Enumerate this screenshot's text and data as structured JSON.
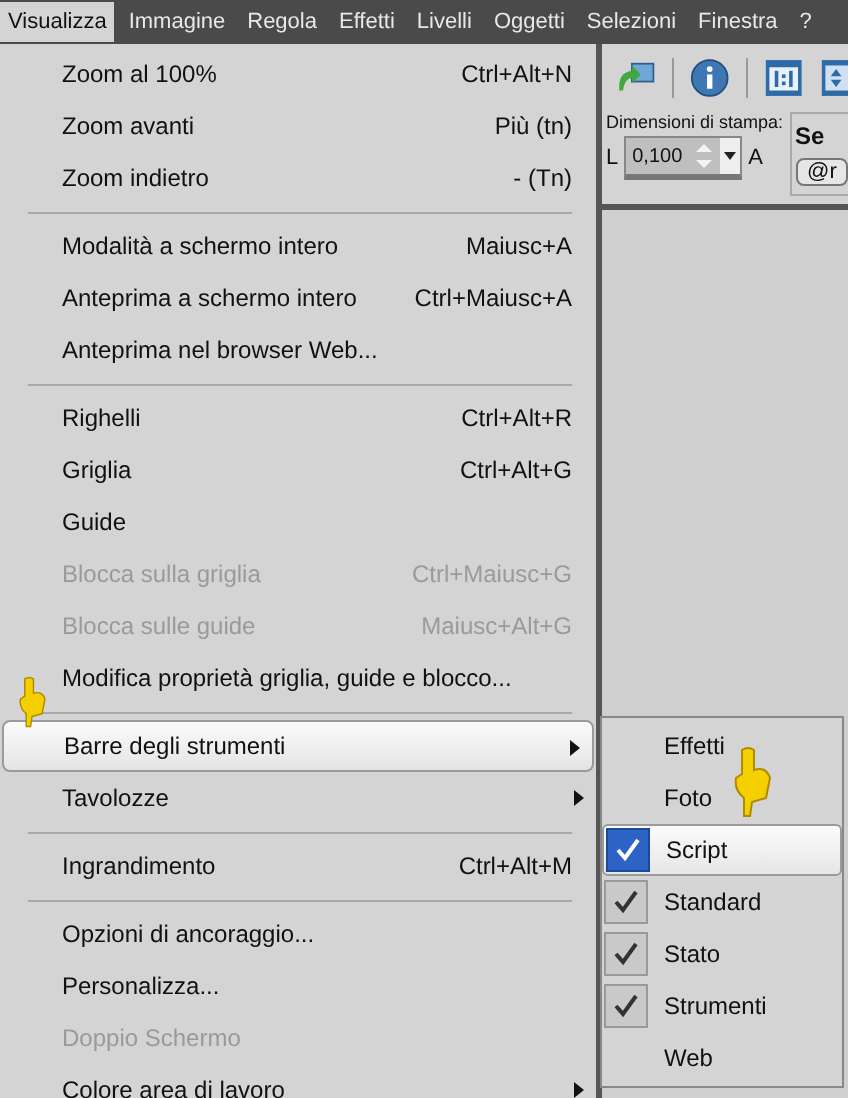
{
  "menubar": [
    {
      "label": "Visualizza",
      "selected": true
    },
    {
      "label": "Immagine",
      "selected": false
    },
    {
      "label": "Regola",
      "selected": false
    },
    {
      "label": "Effetti",
      "selected": false
    },
    {
      "label": "Livelli",
      "selected": false
    },
    {
      "label": "Oggetti",
      "selected": false
    },
    {
      "label": "Selezioni",
      "selected": false
    },
    {
      "label": "Finestra",
      "selected": false
    },
    {
      "label": "?",
      "selected": false
    }
  ],
  "menu": {
    "items": [
      {
        "kind": "item",
        "label": "Zoom al 100%",
        "shortcut": "Ctrl+Alt+N",
        "disabled": false,
        "selected": false,
        "submenu": false
      },
      {
        "kind": "item",
        "label": "Zoom avanti",
        "shortcut": "Più (tn)",
        "disabled": false,
        "selected": false,
        "submenu": false
      },
      {
        "kind": "item",
        "label": "Zoom indietro",
        "shortcut": "- (Tn)",
        "disabled": false,
        "selected": false,
        "submenu": false
      },
      {
        "kind": "separator"
      },
      {
        "kind": "item",
        "label": "Modalità a schermo intero",
        "shortcut": "Maiusc+A",
        "disabled": false,
        "selected": false,
        "submenu": false
      },
      {
        "kind": "item",
        "label": "Anteprima a schermo intero",
        "shortcut": "Ctrl+Maiusc+A",
        "disabled": false,
        "selected": false,
        "submenu": false
      },
      {
        "kind": "item",
        "label": "Anteprima nel browser Web...",
        "disabled": false,
        "selected": false,
        "submenu": false
      },
      {
        "kind": "separator"
      },
      {
        "kind": "item",
        "label": "Righelli",
        "shortcut": "Ctrl+Alt+R",
        "disabled": false,
        "selected": false,
        "submenu": false
      },
      {
        "kind": "item",
        "label": "Griglia",
        "shortcut": "Ctrl+Alt+G",
        "disabled": false,
        "selected": false,
        "submenu": false
      },
      {
        "kind": "item",
        "label": "Guide",
        "disabled": false,
        "selected": false,
        "submenu": false
      },
      {
        "kind": "item",
        "label": "Blocca sulla griglia",
        "shortcut": "Ctrl+Maiusc+G",
        "disabled": true,
        "selected": false,
        "submenu": false
      },
      {
        "kind": "item",
        "label": "Blocca sulle guide",
        "shortcut": "Maiusc+Alt+G",
        "disabled": true,
        "selected": false,
        "submenu": false
      },
      {
        "kind": "item",
        "label": "Modifica proprietà griglia, guide e blocco...",
        "disabled": false,
        "selected": false,
        "submenu": false
      },
      {
        "kind": "separator"
      },
      {
        "kind": "item",
        "label": "Barre degli strumenti",
        "disabled": false,
        "selected": true,
        "submenu": true
      },
      {
        "kind": "item",
        "label": "Tavolozze",
        "disabled": false,
        "selected": false,
        "submenu": true
      },
      {
        "kind": "separator"
      },
      {
        "kind": "item",
        "label": "Ingrandimento",
        "shortcut": "Ctrl+Alt+M",
        "disabled": false,
        "selected": false,
        "submenu": false
      },
      {
        "kind": "separator"
      },
      {
        "kind": "item",
        "label": "Opzioni di ancoraggio...",
        "disabled": false,
        "selected": false,
        "submenu": false
      },
      {
        "kind": "item",
        "label": "Personalizza...",
        "disabled": false,
        "selected": false,
        "submenu": false
      },
      {
        "kind": "item",
        "label": "Doppio Schermo",
        "disabled": true,
        "selected": false,
        "submenu": false
      },
      {
        "kind": "item",
        "label": "Colore area di lavoro",
        "disabled": false,
        "selected": false,
        "submenu": true
      }
    ]
  },
  "submenu": {
    "items": [
      {
        "label": "Effetti",
        "checked": false,
        "selected": false
      },
      {
        "label": "Foto",
        "checked": false,
        "selected": false
      },
      {
        "label": "Script",
        "checked": true,
        "selected": true
      },
      {
        "label": "Standard",
        "checked": true,
        "selected": false
      },
      {
        "label": "Stato",
        "checked": true,
        "selected": false
      },
      {
        "label": "Strumenti",
        "checked": true,
        "selected": false
      },
      {
        "label": "Web",
        "checked": false,
        "selected": false
      }
    ]
  },
  "print_size": {
    "label": "Dimensioni di stampa:",
    "width_label": "L",
    "value": "0,100",
    "height_label": "A"
  },
  "panel": {
    "title": "Se",
    "chip": "@r"
  }
}
